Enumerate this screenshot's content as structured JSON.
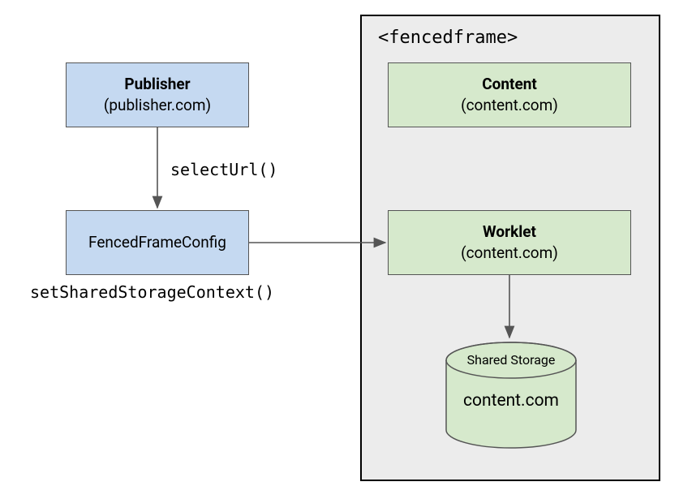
{
  "diagram": {
    "publisher": {
      "title": "Publisher",
      "sub": "(publisher.com)"
    },
    "config": {
      "title": "FencedFrameConfig"
    },
    "frame": {
      "title": "<fencedframe>"
    },
    "content": {
      "title": "Content",
      "sub": "(content.com)"
    },
    "worklet": {
      "title": "Worklet",
      "sub": "(content.com)"
    },
    "storage": {
      "top": "Shared Storage",
      "main": "content.com"
    },
    "labels": {
      "selectUrl": "selectUrl()",
      "setCtx": "setSharedStorageContext()"
    }
  },
  "colors": {
    "blue": "#c5d9f1",
    "green": "#d6e9cc",
    "grey": "#ececec"
  }
}
